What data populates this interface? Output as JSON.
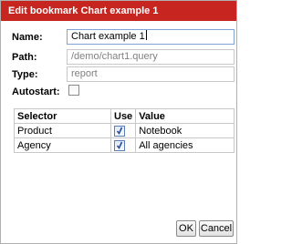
{
  "dialog": {
    "title": "Edit bookmark Chart example 1"
  },
  "form": {
    "name_label": "Name:",
    "name_value": "Chart example 1",
    "path_label": "Path:",
    "path_value": "/demo/chart1.query",
    "type_label": "Type:",
    "type_value": "report",
    "autostart_label": "Autostart:",
    "autostart_checked": false
  },
  "table": {
    "headers": [
      "Selector",
      "Use",
      "Value"
    ],
    "rows": [
      {
        "selector": "Product",
        "use": true,
        "value": "Notebook"
      },
      {
        "selector": "Agency",
        "use": true,
        "value": "All agencies"
      }
    ]
  },
  "buttons": {
    "ok": "OK",
    "cancel": "Cancel"
  },
  "colors": {
    "titlebar": "#c62520",
    "checkmark": "#2a4f8f"
  }
}
